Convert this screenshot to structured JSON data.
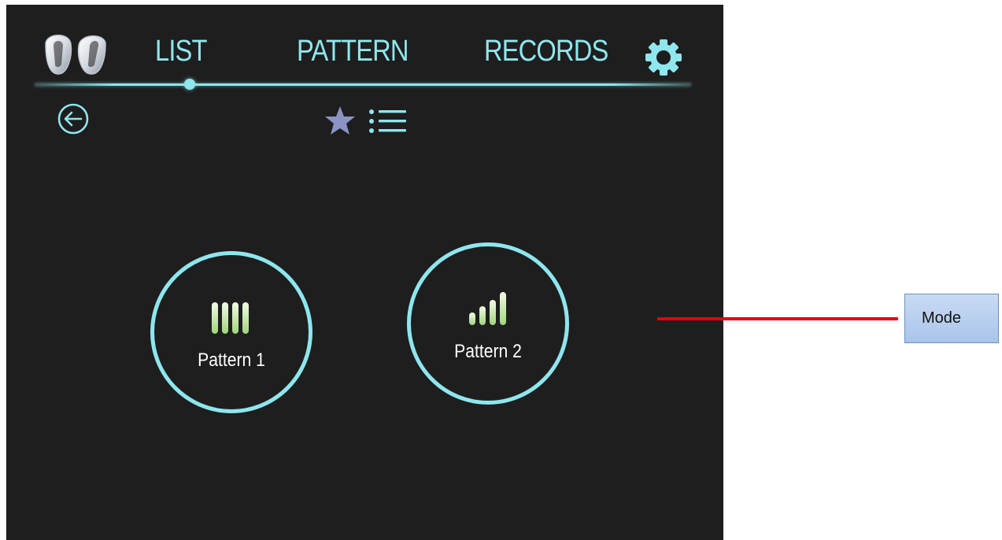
{
  "nav": {
    "tabs": [
      {
        "label": "LIST",
        "active": true
      },
      {
        "label": "PATTERN",
        "active": false
      },
      {
        "label": "RECORDS",
        "active": false
      }
    ]
  },
  "icons": {
    "device": "earbuds-icon",
    "settings": "gear-icon",
    "back": "back-arrow-icon",
    "favorite": "star-icon",
    "list": "list-icon"
  },
  "patterns": [
    {
      "label": "Pattern 1",
      "icon": "equal-bars-icon"
    },
    {
      "label": "Pattern 2",
      "icon": "ascending-bars-icon"
    }
  ],
  "callout": {
    "label": "Mode"
  },
  "colors": {
    "accent": "#8ee6ee",
    "background": "#1e1e1e",
    "star": "#8a93c4",
    "callout_line": "#e8000b",
    "callout_box": "#b8cfee"
  }
}
